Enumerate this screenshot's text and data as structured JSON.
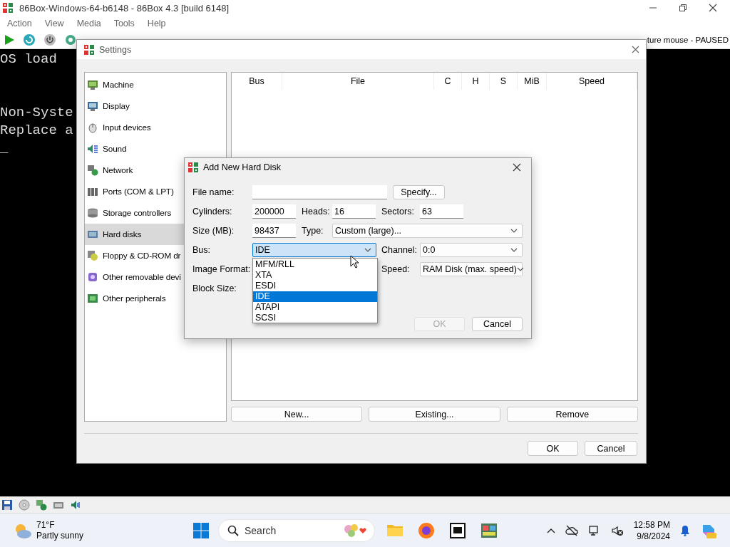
{
  "main_window": {
    "title": "86Box-Windows-64-b6148 - 86Box 4.3 [build 6148]",
    "menu": [
      "Action",
      "View",
      "Media",
      "Tools",
      "Help"
    ],
    "status_text": "ture mouse - PAUSED",
    "console_blocks": [
      [
        "OS load"
      ],
      [
        "Non-Syste",
        "Replace a",
        "_"
      ]
    ]
  },
  "settings": {
    "title": "Settings",
    "categories": [
      {
        "label": "Machine",
        "selected": false
      },
      {
        "label": "Display",
        "selected": false
      },
      {
        "label": "Input devices",
        "selected": false
      },
      {
        "label": "Sound",
        "selected": false
      },
      {
        "label": "Network",
        "selected": false
      },
      {
        "label": "Ports (COM & LPT)",
        "selected": false
      },
      {
        "label": "Storage controllers",
        "selected": false
      },
      {
        "label": "Hard disks",
        "selected": true
      },
      {
        "label": "Floppy & CD-ROM dr",
        "selected": false
      },
      {
        "label": "Other removable devi",
        "selected": false
      },
      {
        "label": "Other peripherals",
        "selected": false
      }
    ],
    "disks_table": {
      "columns": [
        "Bus",
        "File",
        "C",
        "H",
        "S",
        "MiB",
        "Speed"
      ]
    },
    "disk_buttons": [
      "New...",
      "Existing...",
      "Remove"
    ],
    "buttons": [
      "OK",
      "Cancel"
    ]
  },
  "add_hard_disk": {
    "title": "Add New Hard Disk",
    "file_name": {
      "label": "File name:"
    },
    "specify_button": "Specify...",
    "cylinders": {
      "label": "Cylinders:",
      "value": "200000"
    },
    "heads": {
      "label": "Heads:",
      "value": "16"
    },
    "sectors": {
      "label": "Sectors:",
      "value": "63"
    },
    "size": {
      "label": "Size (MB):",
      "value": "98437"
    },
    "type": {
      "label": "Type:",
      "value": "Custom (large)..."
    },
    "bus": {
      "label": "Bus:",
      "value": "IDE",
      "expanded": true,
      "options": [
        {
          "label": "MFM/RLL",
          "selected": false
        },
        {
          "label": "XTA",
          "selected": false
        },
        {
          "label": "ESDI",
          "selected": false
        },
        {
          "label": "IDE",
          "selected": true
        },
        {
          "label": "ATAPI",
          "selected": false
        },
        {
          "label": "SCSI",
          "selected": false
        }
      ]
    },
    "channel": {
      "label": "Channel:",
      "value": "0:0"
    },
    "image_format": {
      "label": "Image Format:"
    },
    "speed": {
      "label": "Speed:",
      "value": "RAM Disk (max. speed)"
    },
    "block_size": {
      "label": "Block Size:"
    },
    "buttons": [
      {
        "label": "OK",
        "disabled": true
      },
      {
        "label": "Cancel",
        "disabled": false
      }
    ]
  },
  "taskbar": {
    "weather": {
      "temperature": "71°F",
      "condition": "Partly sunny"
    },
    "search": {
      "placeholder": "Search"
    },
    "clock": {
      "time": "12:58 PM",
      "date": "9/8/2024"
    }
  }
}
